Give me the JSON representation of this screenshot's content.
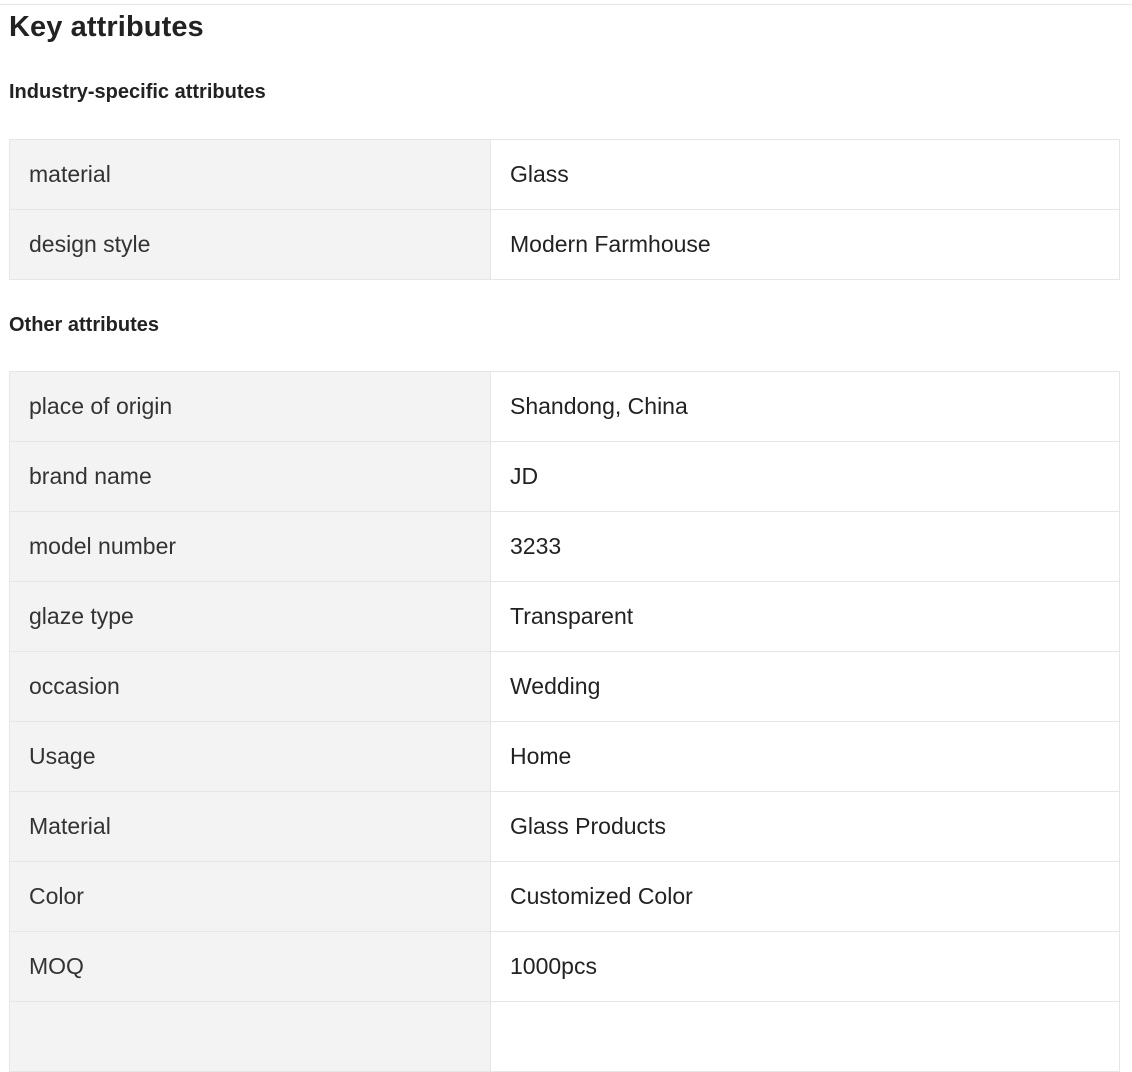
{
  "title": "Key attributes",
  "industry_section": {
    "heading": "Industry-specific attributes",
    "rows": [
      {
        "key": "material",
        "value": "Glass"
      },
      {
        "key": "design style",
        "value": "Modern Farmhouse"
      }
    ]
  },
  "other_section": {
    "heading": "Other attributes",
    "rows": [
      {
        "key": "place of origin",
        "value": "Shandong, China"
      },
      {
        "key": "brand name",
        "value": "JD"
      },
      {
        "key": "model number",
        "value": "3233"
      },
      {
        "key": "glaze type",
        "value": "Transparent"
      },
      {
        "key": "occasion",
        "value": "Wedding"
      },
      {
        "key": "Usage",
        "value": "Home"
      },
      {
        "key": "Material",
        "value": "Glass Products"
      },
      {
        "key": "Color",
        "value": "Customized Color"
      },
      {
        "key": "MOQ",
        "value": "1000pcs"
      },
      {
        "key": "",
        "value": ""
      }
    ]
  }
}
